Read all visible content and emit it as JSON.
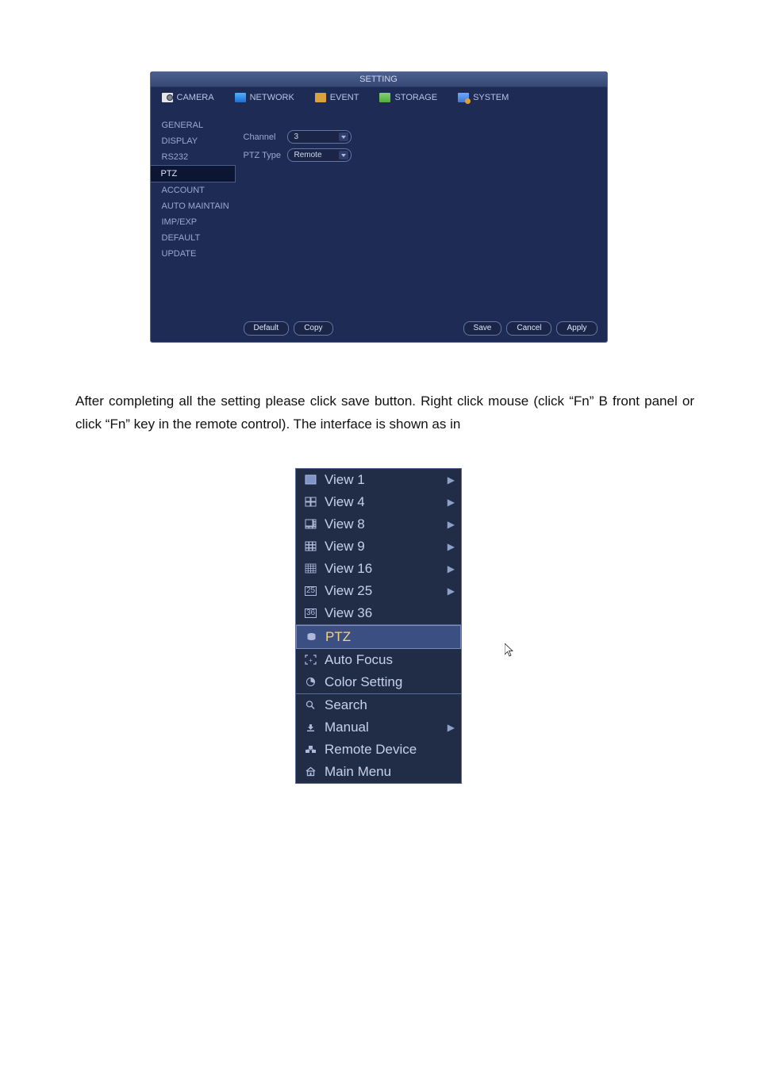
{
  "setting_window": {
    "title": "SETTING",
    "tabs": [
      {
        "label": "CAMERA"
      },
      {
        "label": "NETWORK"
      },
      {
        "label": "EVENT"
      },
      {
        "label": "STORAGE"
      },
      {
        "label": "SYSTEM"
      }
    ],
    "sidebar": [
      "GENERAL",
      "DISPLAY",
      "RS232",
      "PTZ",
      "ACCOUNT",
      "AUTO MAINTAIN",
      "IMP/EXP",
      "DEFAULT",
      "UPDATE"
    ],
    "sidebar_active_index": 3,
    "form": {
      "channel_label": "Channel",
      "channel_value": "3",
      "ptztype_label": "PTZ Type",
      "ptztype_value": "Remote"
    },
    "buttons": {
      "default": "Default",
      "copy": "Copy",
      "save": "Save",
      "cancel": "Cancel",
      "apply": "Apply"
    }
  },
  "body_text": "After completing all the setting please click save button. Right click mouse (click “Fn” B front panel or click “Fn” key in the remote control). The interface is shown as in",
  "context_menu": {
    "sections": [
      [
        {
          "icon": "view1-icon",
          "label": "View 1",
          "arrow": true
        },
        {
          "icon": "view4-icon",
          "label": "View 4",
          "arrow": true
        },
        {
          "icon": "view8-icon",
          "label": "View 8",
          "arrow": true
        },
        {
          "icon": "view9-icon",
          "label": "View 9",
          "arrow": true
        },
        {
          "icon": "view16-icon",
          "label": "View 16",
          "arrow": true
        },
        {
          "icon": "view25-icon",
          "label": "View 25",
          "arrow": true
        },
        {
          "icon": "view36-icon",
          "label": "View 36",
          "arrow": false
        }
      ],
      [
        {
          "icon": "ptz-icon",
          "label": "PTZ",
          "arrow": false,
          "selected": true
        },
        {
          "icon": "autofocus-icon",
          "label": "Auto Focus",
          "arrow": false
        },
        {
          "icon": "color-icon",
          "label": "Color Setting",
          "arrow": false
        }
      ],
      [
        {
          "icon": "search-icon",
          "label": "Search",
          "arrow": false
        },
        {
          "icon": "manual-icon",
          "label": "Manual",
          "arrow": true
        },
        {
          "icon": "remote-device-icon",
          "label": "Remote Device",
          "arrow": false
        },
        {
          "icon": "home-icon",
          "label": "Main Menu",
          "arrow": false
        }
      ]
    ]
  }
}
